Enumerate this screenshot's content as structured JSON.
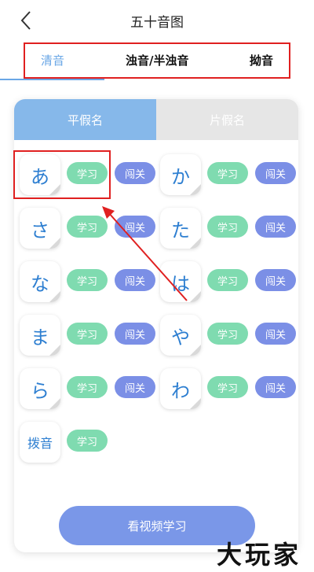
{
  "header": {
    "title": "五十音图"
  },
  "top_tabs": [
    {
      "label": "清音",
      "active": true
    },
    {
      "label": "浊音/半浊音",
      "active": false
    },
    {
      "label": "拗音",
      "active": false
    }
  ],
  "segments": {
    "hiragana": "平假名",
    "katakana": "片假名"
  },
  "kana": [
    {
      "char": "あ"
    },
    {
      "char": "か"
    },
    {
      "char": "さ"
    },
    {
      "char": "た"
    },
    {
      "char": "な"
    },
    {
      "char": "は"
    },
    {
      "char": "ま"
    },
    {
      "char": "や"
    },
    {
      "char": "ら"
    },
    {
      "char": "わ"
    },
    {
      "char": "拨音"
    }
  ],
  "buttons": {
    "study": "学习",
    "pass": "闯关",
    "video": "看视频学习"
  },
  "watermark": "大玩家",
  "colors": {
    "accent": "#6aa7e6",
    "study": "#7fdbb0",
    "pass": "#7b8fe6",
    "highlight": "#e02020"
  }
}
